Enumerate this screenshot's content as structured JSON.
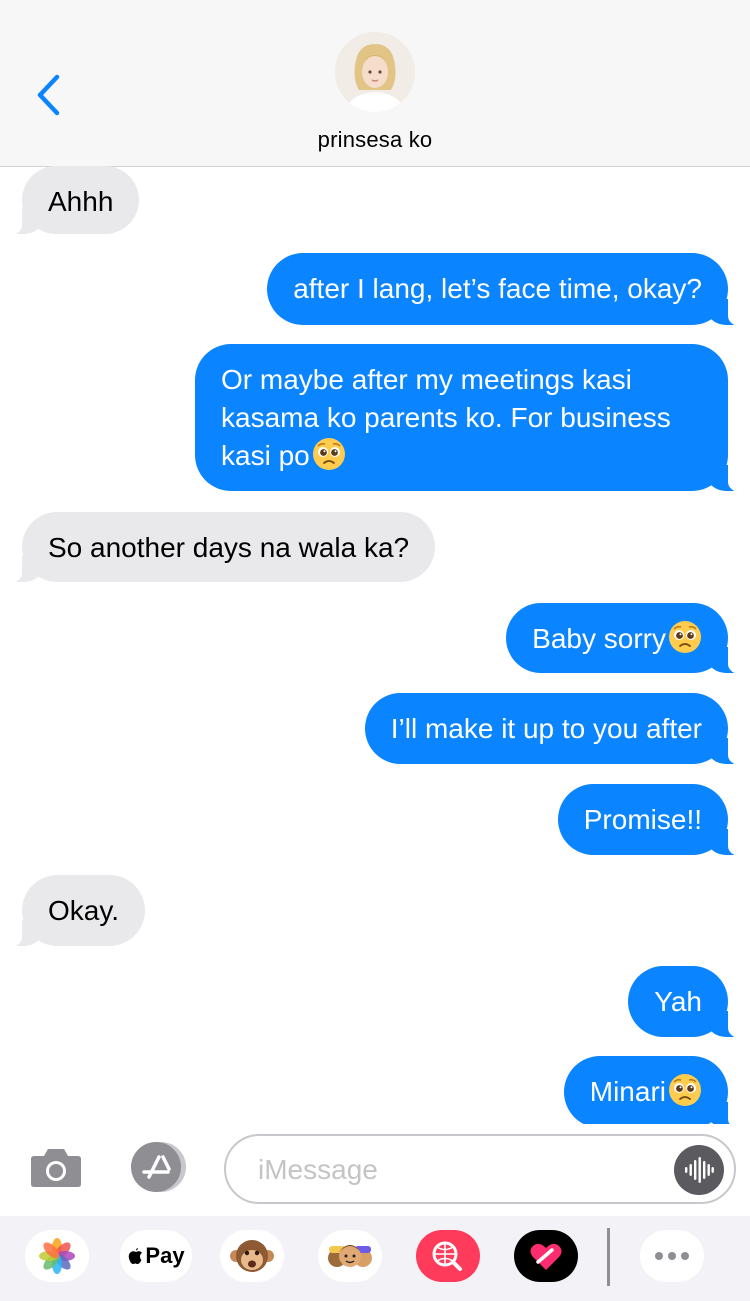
{
  "header": {
    "contact_name": "prinsesa ko",
    "back_icon": "chevron-left-icon",
    "accent_color": "#0a84ff"
  },
  "messages": [
    {
      "direction": "incoming",
      "text": "Ahhh"
    },
    {
      "direction": "outgoing",
      "text": "after I lang, let’s face time, okay?"
    },
    {
      "direction": "outgoing",
      "text": "Or maybe after my meetings kasi kasama ko parents ko. For business kasi po",
      "emoji": "pleading-face"
    },
    {
      "direction": "incoming",
      "text": "So another days na wala ka?"
    },
    {
      "direction": "outgoing",
      "text": "Baby sorry",
      "emoji": "pleading-face"
    },
    {
      "direction": "outgoing",
      "text": "I’ll make it up to you after"
    },
    {
      "direction": "outgoing",
      "text": "Promise!!"
    },
    {
      "direction": "incoming",
      "text": "Okay."
    },
    {
      "direction": "outgoing",
      "text": "Yah"
    },
    {
      "direction": "outgoing",
      "text": "Minari",
      "emoji": "pleading-face"
    }
  ],
  "compose": {
    "placeholder": "iMessage",
    "camera_icon": "camera-icon",
    "apps_icon": "app-store-icon",
    "audio_icon": "audio-waveform-icon"
  },
  "app_drawer": {
    "items": [
      {
        "name": "photos-icon"
      },
      {
        "name": "apple-pay-icon",
        "label": "Pay"
      },
      {
        "name": "animoji-monkey-icon"
      },
      {
        "name": "memoji-icon"
      },
      {
        "name": "images-search-icon"
      },
      {
        "name": "digital-touch-icon"
      },
      {
        "name": "more-icon"
      }
    ]
  },
  "colors": {
    "outgoing_bubble": "#0a84ff",
    "incoming_bubble": "#e9e9eb"
  }
}
